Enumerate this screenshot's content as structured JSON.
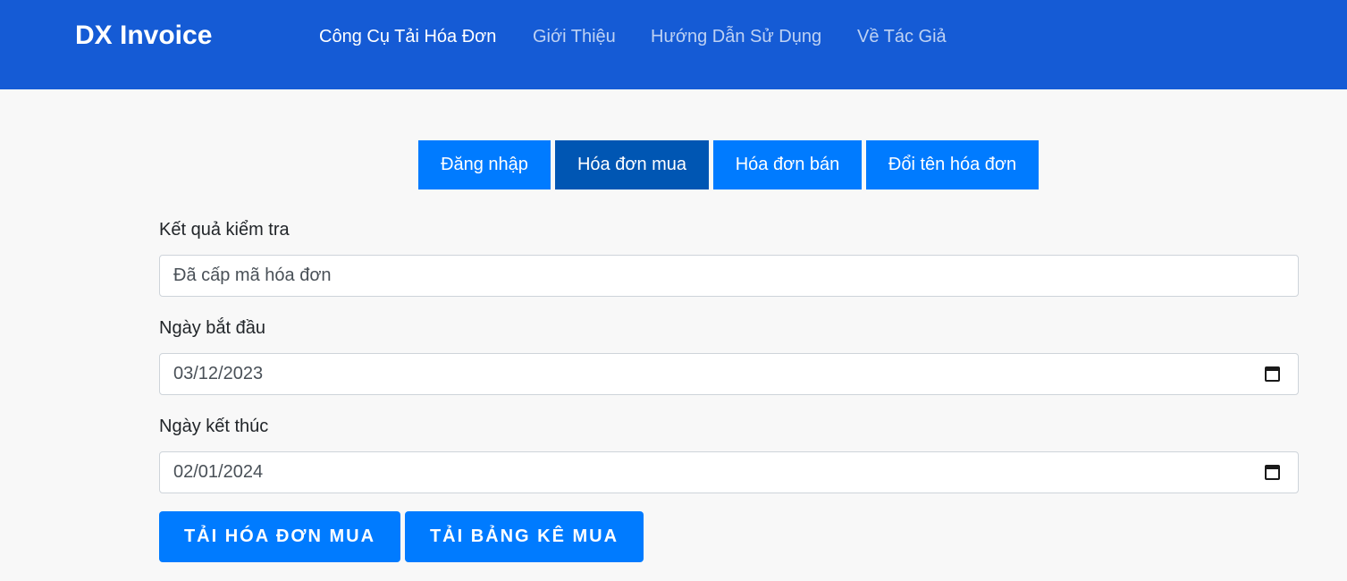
{
  "navbar": {
    "brand": "DX Invoice",
    "links": [
      {
        "label": "Công Cụ Tải Hóa Đơn"
      },
      {
        "label": "Giới Thiệu"
      },
      {
        "label": "Hướng Dẫn Sử Dụng"
      },
      {
        "label": "Về Tác Giả"
      }
    ]
  },
  "tabs": [
    {
      "label": "Đăng nhập"
    },
    {
      "label": "Hóa đơn mua"
    },
    {
      "label": "Hóa đơn bán"
    },
    {
      "label": "Đổi tên hóa đơn"
    }
  ],
  "form": {
    "result": {
      "label": "Kết quả kiểm tra",
      "value": "Đã cấp mã hóa đơn"
    },
    "start_date": {
      "label": "Ngày bắt đầu",
      "value": "03/12/2023",
      "icon": "calendar-icon"
    },
    "end_date": {
      "label": "Ngày kết thúc",
      "value": "02/01/2024",
      "icon": "calendar-icon"
    }
  },
  "actions": {
    "download_invoices": "TẢI HÓA ĐƠN MUA",
    "download_list": "TẢI BẢNG KÊ MUA"
  },
  "colors": {
    "navbar": "#155bd5",
    "primary": "#007bff",
    "primary_active": "#0056b3"
  }
}
